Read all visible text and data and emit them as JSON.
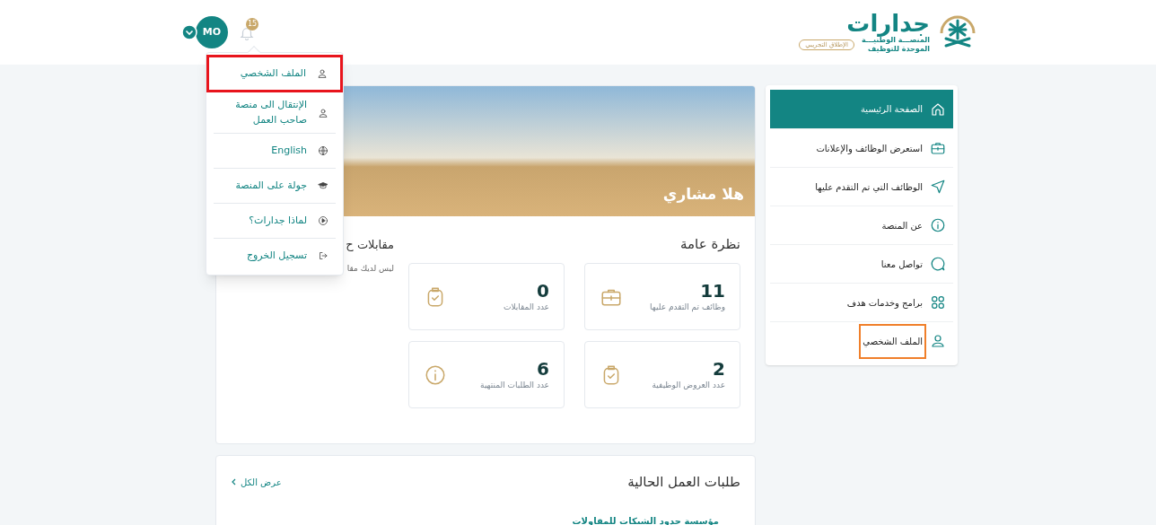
{
  "header": {
    "logo": {
      "name": "جدارات",
      "subtitle_lines": [
        "المنصـــة الوطنيـــة",
        "الموحدة للتوظيف"
      ],
      "badge": "الإطلاق التجريبي"
    },
    "avatar": {
      "initials": "MO"
    },
    "notifications": {
      "count": "15"
    }
  },
  "user_menu": {
    "items": [
      {
        "kind": "profile",
        "label": "الملف الشخصي",
        "highlighted": true
      },
      {
        "kind": "switch",
        "label": "الإنتقال الى منصة صاحب العمل",
        "highlighted": false
      },
      {
        "kind": "language",
        "label": "English",
        "highlighted": false
      },
      {
        "kind": "tour",
        "label": "جولة على المنصة",
        "highlighted": false
      },
      {
        "kind": "why",
        "label": "لماذا جدارات؟",
        "highlighted": false
      },
      {
        "kind": "logout",
        "label": "تسجيل الخروج",
        "highlighted": false
      }
    ]
  },
  "sidebar": {
    "items": [
      {
        "kind": "home",
        "label": "الصفحة الرئيسية",
        "selected": true,
        "highlighted": false
      },
      {
        "kind": "jobs",
        "label": "استعرض الوظائف والإعلانات",
        "selected": false,
        "highlighted": false
      },
      {
        "kind": "applied",
        "label": "الوظائف التي تم التقدم عليها",
        "selected": false,
        "highlighted": false
      },
      {
        "kind": "about",
        "label": "عن المنصة",
        "selected": false,
        "highlighted": false
      },
      {
        "kind": "contact",
        "label": "تواصل معنا",
        "selected": false,
        "highlighted": false
      },
      {
        "kind": "programs",
        "label": "برامج وخدمات هدف",
        "selected": false,
        "highlighted": false
      },
      {
        "kind": "profile",
        "label": "الملف الشخصي",
        "selected": false,
        "highlighted": true
      }
    ]
  },
  "hero": {
    "greeting": "هلا مشاري"
  },
  "overview": {
    "title": "نظرة عامة",
    "stats": [
      {
        "kind": "briefcase",
        "value": "11",
        "label": "وظائف تم التقدم عليها"
      },
      {
        "kind": "clipboard",
        "value": "0",
        "label": "عدد المقابلات"
      },
      {
        "kind": "clipboard",
        "value": "2",
        "label": "عدد العروض الوظيفية"
      },
      {
        "kind": "info",
        "value": "6",
        "label": "عدد الطلبات المنتهية"
      }
    ]
  },
  "interviews": {
    "title": "مقابلات ح",
    "message": "ليس لديك مقا"
  },
  "applications": {
    "title": "طلبات العمل الحالية",
    "view_all": "عرض الكل",
    "rows": [
      {
        "company": "مؤسسة حدود الشبكات للمقاولات"
      }
    ]
  }
}
